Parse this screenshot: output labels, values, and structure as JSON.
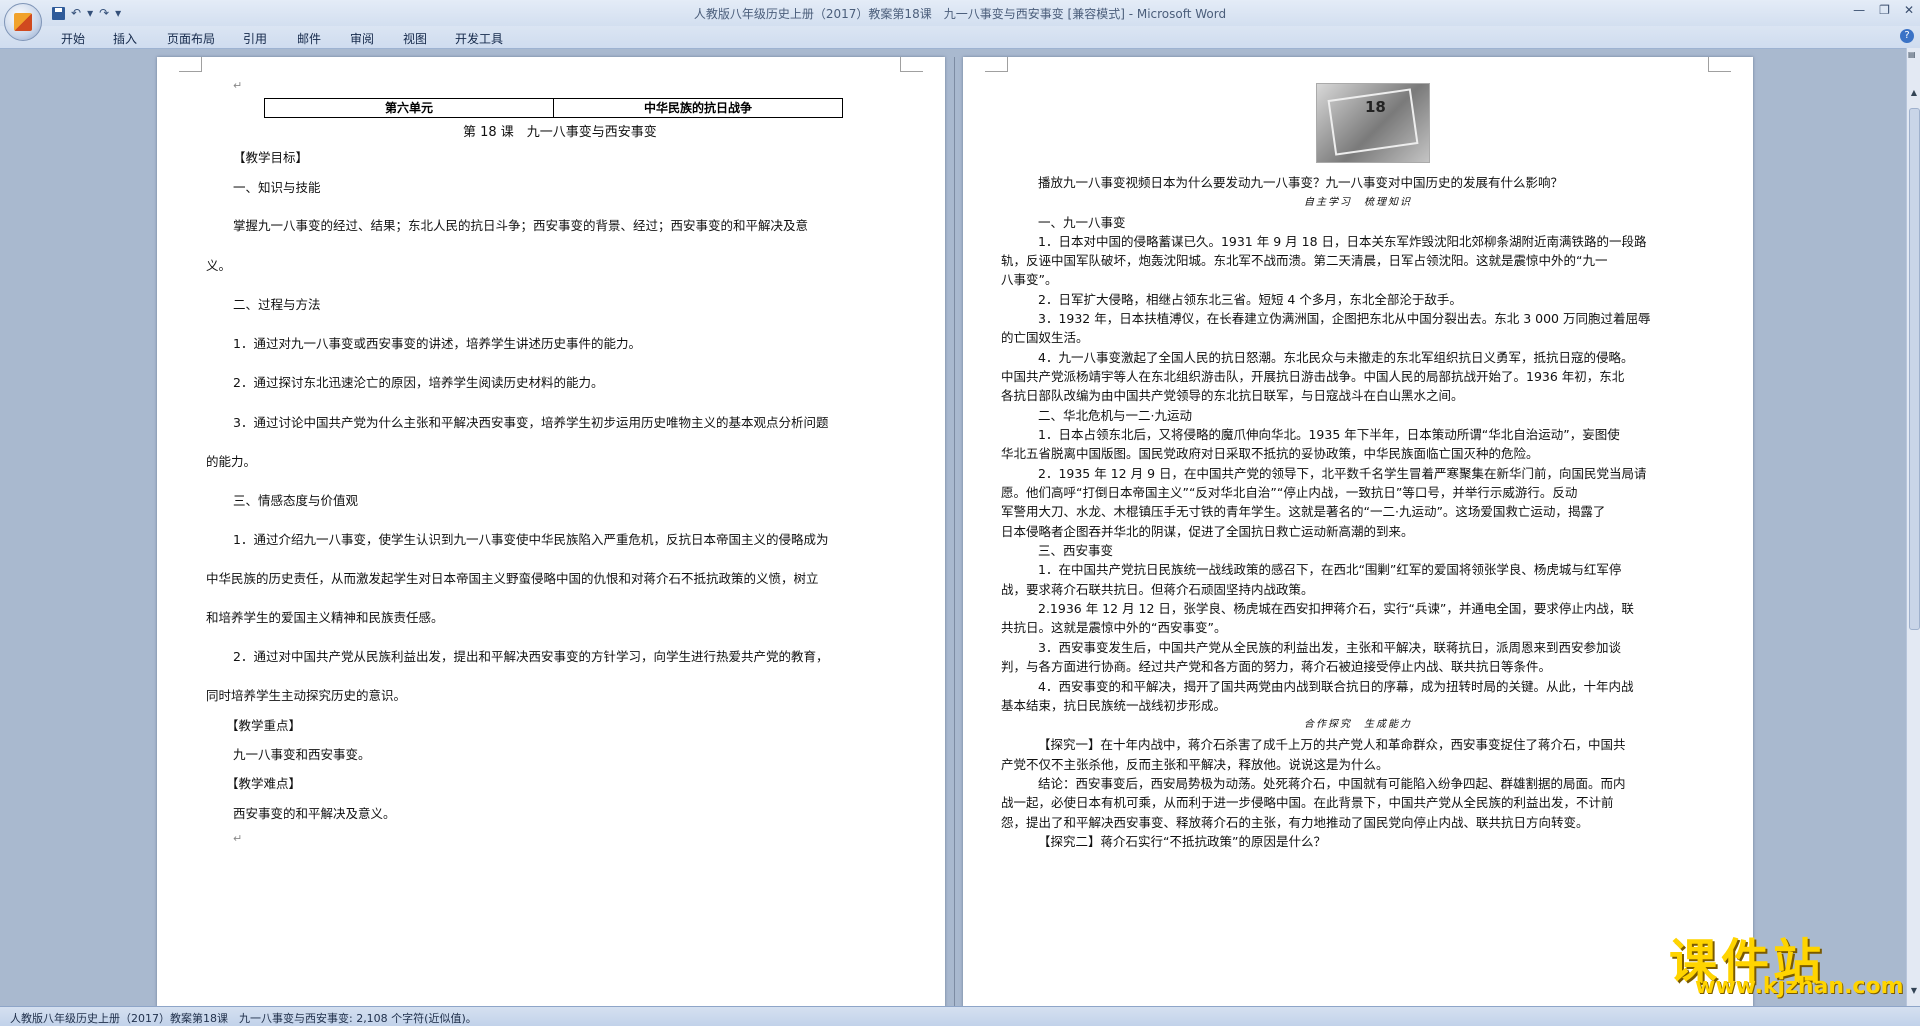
{
  "window": {
    "title": "人教版八年级历史上册（2017）教案第18课　九一八事变与西安事变 [兼容模式] - Microsoft Word",
    "qat": [
      "▾"
    ]
  },
  "ribbon_tabs": [
    "开始",
    "插入",
    "页面布局",
    "引用",
    "邮件",
    "审阅",
    "视图",
    "开发工具"
  ],
  "page1": {
    "unit_left": "第六单元",
    "unit_right": "中华民族的抗日战争",
    "lesson_title": "第 18 课　九一八事变与西安事变",
    "lines": [
      "【教学目标】",
      "一、知识与技能",
      "掌握九一八事变的经过、结果；东北人民的抗日斗争；西安事变的背景、经过；西安事变的和平解决及意",
      "义。",
      "二、过程与方法",
      "1．通过对九一八事变或西安事变的讲述，培养学生讲述历史事件的能力。",
      "2．通过探讨东北迅速沦亡的原因，培养学生阅读历史材料的能力。",
      "3．通过讨论中国共产党为什么主张和平解决西安事变，培养学生初步运用历史唯物主义的基本观点分析问题",
      "的能力。",
      "三、情感态度与价值观",
      "1．通过介绍九一八事变，使学生认识到九一八事变使中华民族陷入严重危机，反抗日本帝国主义的侵略成为",
      "中华民族的历史责任，从而激发起学生对日本帝国主义野蛮侵略中国的仇恨和对蒋介石不抵抗政策的义愤，树立",
      "和培养学生的爱国主义精神和民族责任感。",
      "2．通过对中国共产党从民族利益出发，提出和平解决西安事变的方针学习，向学生进行热爱共产党的教育，",
      "同时培养学生主动探究历史的意识。",
      "【教学重点】",
      "九一八事变和西安事变。",
      "【教学难点】",
      "西安事变的和平解决及意义。"
    ]
  },
  "page2": {
    "photo_number": "18",
    "intro": "播放九一八事变视频日本为什么要发动九一八事变？九一八事变对中国历史的发展有什么影响？",
    "sub1": "自主学习　梳理知识",
    "lines": [
      "一、九一八事变",
      "1．日本对中国的侵略蓄谋已久。1931 年 9 月 18 日，日本关东军炸毁沈阳北郊柳条湖附近南满铁路的一段路",
      "轨，反诬中国军队破坏，炮轰沈阳城。东北军不战而溃。第二天清晨，日军占领沈阳。这就是震惊中外的“九一",
      "八事变”。",
      "2．日军扩大侵略，相继占领东北三省。短短 4 个多月，东北全部沦于敌手。",
      "3．1932 年，日本扶植溥仪，在长春建立伪满洲国，企图把东北从中国分裂出去。东北 3 000 万同胞过着屈辱",
      "的亡国奴生活。",
      "4．九一八事变激起了全国人民的抗日怒潮。东北民众与未撤走的东北军组织抗日义勇军，抵抗日寇的侵略。",
      "中国共产党派杨靖宇等人在东北组织游击队，开展抗日游击战争。中国人民的局部抗战开始了。1936 年初，东北",
      "各抗日部队改编为由中国共产党领导的东北抗日联军，与日寇战斗在白山黑水之间。",
      "二、华北危机与一二·九运动",
      "1．日本占领东北后，又将侵略的魔爪伸向华北。1935 年下半年，日本策动所谓“华北自治运动”，妄图使",
      "华北五省脱离中国版图。国民党政府对日采取不抵抗的妥协政策，中华民族面临亡国灭种的危险。",
      "2．1935 年 12 月 9 日，在中国共产党的领导下，北平数千名学生冒着严寒聚集在新华门前，向国民党当局请",
      "愿。他们高呼“打倒日本帝国主义”“反对华北自治”“停止内战，一致抗日”等口号，并举行示威游行。反动",
      "军警用大刀、水龙、木棍镇压手无寸铁的青年学生。这就是著名的“一二·九运动”。这场爱国救亡运动，揭露了",
      "日本侵略者企图吞并华北的阴谋，促进了全国抗日救亡运动新高潮的到来。",
      "三、西安事变",
      "1．在中国共产党抗日民族统一战线政策的感召下，在西北“围剿”红军的爱国将领张学良、杨虎城与红军停",
      "战，要求蒋介石联共抗日。但蒋介石顽固坚持内战政策。",
      "2.1936 年 12 月 12 日，张学良、杨虎城在西安扣押蒋介石，实行“兵谏”，并通电全国，要求停止内战，联",
      "共抗日。这就是震惊中外的“西安事变”。",
      "3．西安事变发生后，中国共产党从全民族的利益出发，主张和平解决，联蒋抗日，派周恩来到西安参加谈",
      "判，与各方面进行协商。经过共产党和各方面的努力，蒋介石被迫接受停止内战、联共抗日等条件。",
      "4．西安事变的和平解决，揭开了国共两党由内战到联合抗日的序幕，成为扭转时局的关键。从此，十年内战",
      "基本结束，抗日民族统一战线初步形成。"
    ],
    "sub2": "合作探究　生成能力",
    "lines2": [
      "【探究一】在十年内战中，蒋介石杀害了成千上万的共产党人和革命群众，西安事变捉住了蒋介石，中国共",
      "产党不仅不主张杀他，反而主张和平解决，释放他。说说这是为什么。",
      "结论：西安事变后，西安局势极为动荡。处死蒋介石，中国就有可能陷入纷争四起、群雄割据的局面。而内",
      "战一起，必使日本有机可乘，从而利于进一步侵略中国。在此背景下，中国共产党从全民族的利益出发，不计前",
      "怨，提出了和平解决西安事变、释放蒋介石的主张，有力地推动了国民党向停止内战、联共抗日方向转变。",
      "【探究二】蒋介石实行“不抵抗政策”的原因是什么？"
    ]
  },
  "status": {
    "text": "人教版八年级历史上册（2017）教案第18课　九一八事变与西安事变: 2,108 个字符(近似值)。"
  },
  "watermark": {
    "main": "课件站",
    "url": "www.kjzhan.com"
  },
  "colors": {
    "workspace": "#a9b9cf",
    "ribbon": "#dbe5f3",
    "watermark": "#ffd400"
  }
}
